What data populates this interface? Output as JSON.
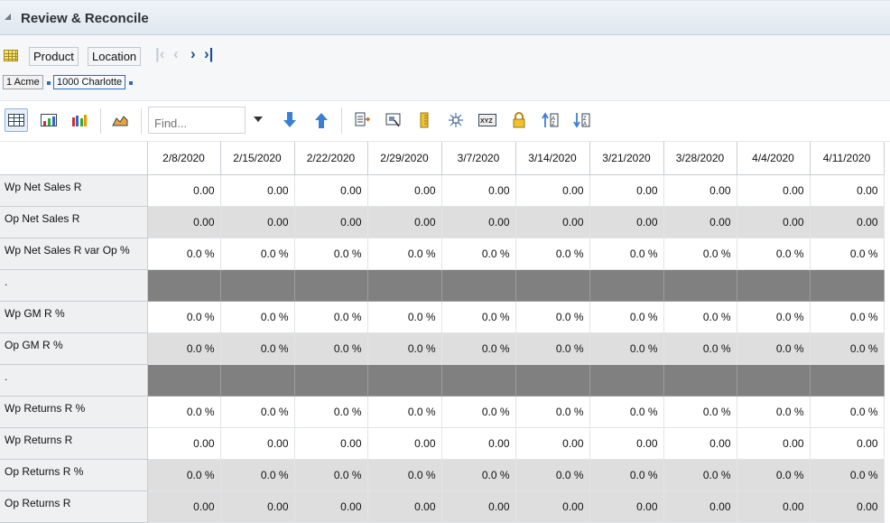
{
  "header": {
    "title": "Review & Reconcile"
  },
  "dimensions": {
    "product_label": "Product",
    "location_label": "Location"
  },
  "breadcrumb": {
    "product": "1 Acme",
    "location": "1000 Charlotte"
  },
  "toolbar": {
    "find_placeholder": "Find..."
  },
  "icons": {
    "grid": "grid-icon",
    "first": "first-page-icon",
    "prev": "previous-page-icon",
    "next": "next-page-icon",
    "last": "last-page-icon"
  },
  "grid": {
    "columns": [
      "2/8/2020",
      "2/15/2020",
      "2/22/2020",
      "2/29/2020",
      "3/7/2020",
      "3/14/2020",
      "3/21/2020",
      "3/28/2020",
      "4/4/2020",
      "4/11/2020"
    ],
    "rows": [
      {
        "label": "Wp Net Sales R",
        "style": "white",
        "values": [
          "0.00",
          "0.00",
          "0.00",
          "0.00",
          "0.00",
          "0.00",
          "0.00",
          "0.00",
          "0.00",
          "0.00"
        ]
      },
      {
        "label": "Op Net Sales R",
        "style": "gray",
        "values": [
          "0.00",
          "0.00",
          "0.00",
          "0.00",
          "0.00",
          "0.00",
          "0.00",
          "0.00",
          "0.00",
          "0.00"
        ]
      },
      {
        "label": "Wp Net Sales R var Op %",
        "style": "white",
        "values": [
          "0.0 %",
          "0.0 %",
          "0.0 %",
          "0.0 %",
          "0.0 %",
          "0.0 %",
          "0.0 %",
          "0.0 %",
          "0.0 %",
          "0.0 %"
        ]
      },
      {
        "label": ".",
        "style": "sep",
        "values": [
          "",
          "",
          "",
          "",
          "",
          "",
          "",
          "",
          "",
          ""
        ]
      },
      {
        "label": "Wp GM R %",
        "style": "white",
        "values": [
          "0.0 %",
          "0.0 %",
          "0.0 %",
          "0.0 %",
          "0.0 %",
          "0.0 %",
          "0.0 %",
          "0.0 %",
          "0.0 %",
          "0.0 %"
        ]
      },
      {
        "label": "Op GM R %",
        "style": "gray",
        "values": [
          "0.0 %",
          "0.0 %",
          "0.0 %",
          "0.0 %",
          "0.0 %",
          "0.0 %",
          "0.0 %",
          "0.0 %",
          "0.0 %",
          "0.0 %"
        ]
      },
      {
        "label": ".",
        "style": "sep",
        "values": [
          "",
          "",
          "",
          "",
          "",
          "",
          "",
          "",
          "",
          ""
        ]
      },
      {
        "label": "Wp Returns R %",
        "style": "white",
        "values": [
          "0.0 %",
          "0.0 %",
          "0.0 %",
          "0.0 %",
          "0.0 %",
          "0.0 %",
          "0.0 %",
          "0.0 %",
          "0.0 %",
          "0.0 %"
        ]
      },
      {
        "label": "Wp Returns R",
        "style": "white",
        "values": [
          "0.00",
          "0.00",
          "0.00",
          "0.00",
          "0.00",
          "0.00",
          "0.00",
          "0.00",
          "0.00",
          "0.00"
        ]
      },
      {
        "label": "Op Returns R %",
        "style": "gray",
        "values": [
          "0.0 %",
          "0.0 %",
          "0.0 %",
          "0.0 %",
          "0.0 %",
          "0.0 %",
          "0.0 %",
          "0.0 %",
          "0.0 %",
          "0.0 %"
        ]
      },
      {
        "label": "Op Returns R",
        "style": "gray",
        "values": [
          "0.00",
          "0.00",
          "0.00",
          "0.00",
          "0.00",
          "0.00",
          "0.00",
          "0.00",
          "0.00",
          "0.00"
        ]
      }
    ]
  }
}
